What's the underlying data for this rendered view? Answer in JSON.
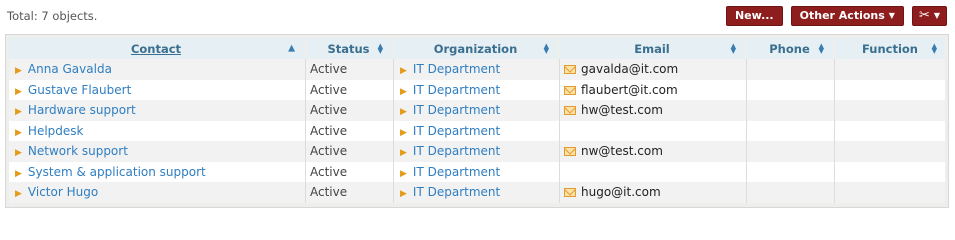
{
  "header": {
    "total_label": "Total: 7 objects."
  },
  "toolbar": {
    "new_label": "New...",
    "other_actions_label": "Other Actions",
    "tools_icon": "tools-icon"
  },
  "table": {
    "columns": [
      {
        "label": "Contact",
        "sort": "asc"
      },
      {
        "label": "Status",
        "sort": "both"
      },
      {
        "label": "Organization",
        "sort": "both"
      },
      {
        "label": "Email",
        "sort": "both"
      },
      {
        "label": "Phone",
        "sort": "both"
      },
      {
        "label": "Function",
        "sort": "both"
      }
    ],
    "rows": [
      {
        "contact": "Anna Gavalda",
        "status": "Active",
        "organization": "IT Department",
        "email": "gavalda@it.com",
        "phone": "",
        "function": ""
      },
      {
        "contact": "Gustave Flaubert",
        "status": "Active",
        "organization": "IT Department",
        "email": "flaubert@it.com",
        "phone": "",
        "function": ""
      },
      {
        "contact": "Hardware support",
        "status": "Active",
        "organization": "IT Department",
        "email": "hw@test.com",
        "phone": "",
        "function": ""
      },
      {
        "contact": "Helpdesk",
        "status": "Active",
        "organization": "IT Department",
        "email": "",
        "phone": "",
        "function": ""
      },
      {
        "contact": "Network support",
        "status": "Active",
        "organization": "IT Department",
        "email": "nw@test.com",
        "phone": "",
        "function": ""
      },
      {
        "contact": "System & application support",
        "status": "Active",
        "organization": "IT Department",
        "email": "",
        "phone": "",
        "function": ""
      },
      {
        "contact": "Victor Hugo",
        "status": "Active",
        "organization": "IT Department",
        "email": "hugo@it.com",
        "phone": "",
        "function": ""
      }
    ]
  },
  "colors": {
    "button_bg": "#8e1e1e",
    "header_bg": "#e6eff3",
    "link": "#2f7ec1",
    "accent_arrow": "#e59b1a"
  }
}
